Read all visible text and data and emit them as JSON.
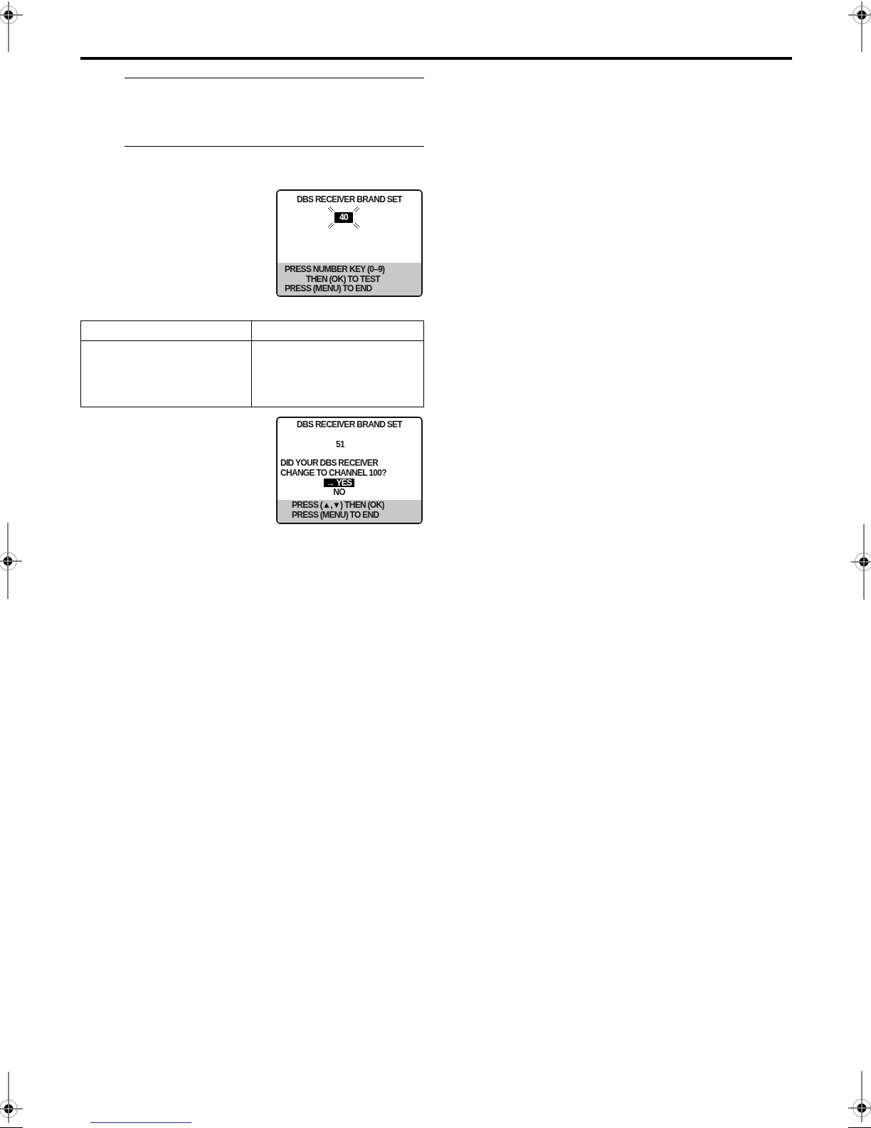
{
  "screens": [
    {
      "title": "DBS RECEIVER BRAND SET",
      "code": {
        "text": "40",
        "blinking": true
      },
      "hint": [
        {
          "text": "PRESS NUMBER KEY (0–9)",
          "kind": "line"
        },
        {
          "text": "THEN (OK) TO TEST",
          "kind": "indented"
        },
        {
          "text": "PRESS (MENU) TO END",
          "kind": "line"
        }
      ]
    },
    {
      "title": "DBS RECEIVER BRAND SET",
      "code": {
        "text": "51",
        "blinking": false
      },
      "question": [
        "DID YOUR DBS RECEIVER",
        "CHANGE TO CHANNEL 100?"
      ],
      "cursor": "→",
      "options": [
        {
          "label": "YES",
          "selected": true
        },
        {
          "label": "NO",
          "selected": false
        }
      ],
      "hint": [
        {
          "text": "PRESS (▲,▼) THEN (OK)",
          "kind": "line"
        },
        {
          "text": "PRESS (MENU) TO END",
          "kind": "line"
        }
      ]
    }
  ]
}
